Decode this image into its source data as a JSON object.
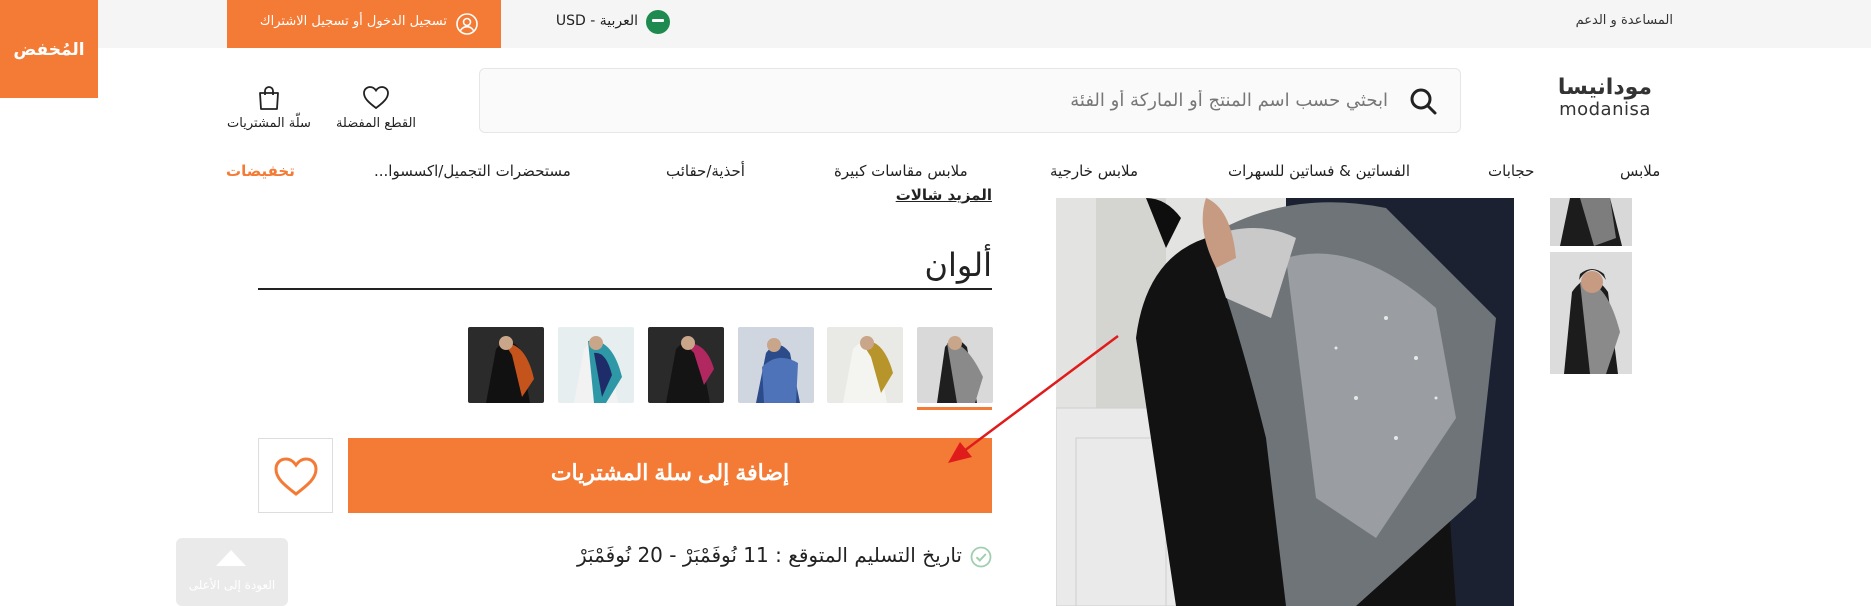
{
  "topbar": {
    "help_label": "المساعدة و الدعم",
    "language_currency": "العربية - USD",
    "login_label": "تسجيل الدخول أو تسجيل الاشتراك"
  },
  "corner_badge": {
    "label": "المُخفض"
  },
  "header": {
    "logo_ar": "مودانيسا",
    "logo_en": "modanisa",
    "search_placeholder": "ابحثي حسب اسم المنتج أو الماركة أو الفئة",
    "favorites_label": "القطع المفضلة",
    "cart_label": "سلّة المشتريات"
  },
  "nav": {
    "items": [
      "ملابس",
      "حجابات",
      "الفساتين & فساتين للسهرات",
      "ملابس خارجية",
      "ملابس مقاسات كبيرة",
      "أحذية/حقائب",
      "مستحضرات التجميل/اكسسوا..."
    ],
    "sale": "تخفيضات"
  },
  "product": {
    "more_colors_label": "المزيد شالات",
    "colors_title": "ألوان",
    "add_to_cart_label": "إضافة إلى سلة المشتريات",
    "delivery_text": "تاريخ التسليم المتوقع : 11 نُوفَمْبَرْ - 20 نُوفَمْبَرْ",
    "back_to_top_label": "العودة إلى الأعلى"
  },
  "colors": {
    "accent": "#f47b35",
    "topbar_bg": "#f5f5f5",
    "flag_green": "#1e8a4f"
  },
  "icons": [
    "user-icon",
    "search-icon",
    "heart-icon",
    "bag-icon",
    "check-circle-icon",
    "chevron-up-icon"
  ]
}
